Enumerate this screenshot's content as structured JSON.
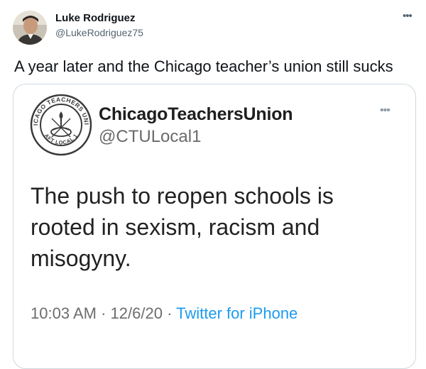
{
  "tweet": {
    "author_name": "Luke Rodriguez",
    "author_handle": "@LukeRodriguez75",
    "text": "A year later and the Chicago teacher’s union still sucks",
    "more_icon": "more-horizontal-icon"
  },
  "quote": {
    "author_name": "ChicagoTeachersUnion",
    "author_handle": "@CTULocal1",
    "text": "The push to reopen schools is rooted in sexism, racism and misogyny.",
    "time": "10:03 AM",
    "separator": "·",
    "date": "12/6/20",
    "source": "Twitter for iPhone",
    "logo": {
      "ring_top": "CHICAGO TEACHERS UNION",
      "ring_bottom": "AFT LOCAL 1"
    }
  },
  "colors": {
    "text_primary": "#0f1419",
    "text_secondary": "#536471",
    "link": "#1d9bf0",
    "border": "#cfd9de"
  }
}
